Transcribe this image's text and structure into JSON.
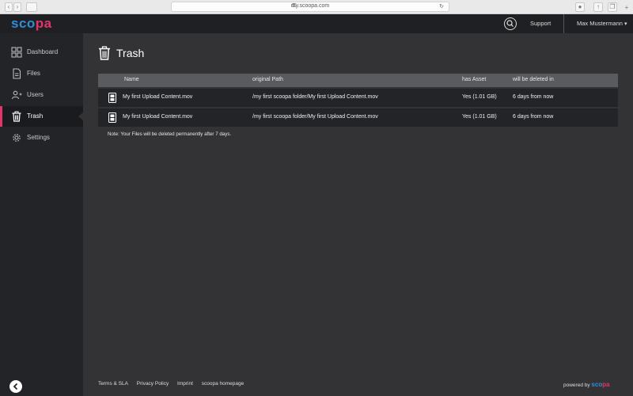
{
  "browser": {
    "url": "my.scoopa.com"
  },
  "brand": {
    "logo_left": "sco",
    "logo_right": "pa",
    "colors": {
      "blue": "#2d8ed8",
      "pink": "#e1356b",
      "sidebar": "#232428",
      "content": "#333335"
    }
  },
  "header": {
    "support_label": "Support",
    "user_name": "Max Mustermann",
    "user_caret": "▾",
    "search_icon": "search-icon"
  },
  "sidebar": {
    "items": [
      {
        "label": "Dashboard",
        "icon": "dashboard-icon",
        "active": false
      },
      {
        "label": "Files",
        "icon": "files-icon",
        "active": false
      },
      {
        "label": "Users",
        "icon": "users-icon",
        "active": false
      },
      {
        "label": "Trash",
        "icon": "trash-icon",
        "active": true
      },
      {
        "label": "Settings",
        "icon": "gear-icon",
        "active": false
      }
    ],
    "collapse_icon": "chevron-left-icon"
  },
  "main": {
    "title": "Trash",
    "table": {
      "columns": [
        "Name",
        "original Path",
        "has Asset",
        "will be deleted in"
      ],
      "rows": [
        {
          "name": "My first Upload Content.mov",
          "path": "/my first scoopa folder/My first Upload Content.mov",
          "asset": "Yes (1.01 GB)",
          "deleted_in": "6 days from now"
        },
        {
          "name": "My first Upload Content.mov",
          "path": "/my first scoopa folder/My first Upload Content.mov",
          "asset": "Yes (1.01 GB)",
          "deleted_in": "6 days from now"
        }
      ]
    },
    "note": "Note: Your Files will be deleted permanently after 7 days."
  },
  "footer": {
    "links": [
      "Terms & SLA",
      "Privacy Policy",
      "Imprint",
      "scoopa homepage"
    ],
    "powered_by": "powered by",
    "powered_logo_left": "sco",
    "powered_logo_right": "pa"
  }
}
